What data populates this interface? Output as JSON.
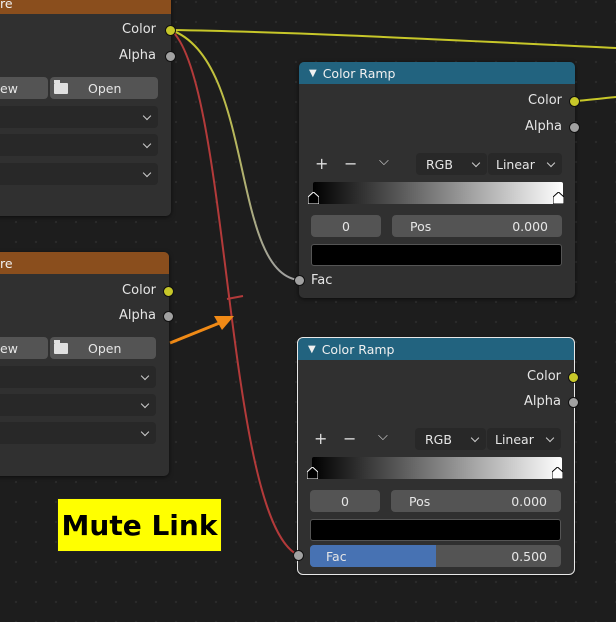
{
  "texture_node_1": {
    "title": "re",
    "outputs": [
      "Color",
      "Alpha"
    ],
    "new_label": "ew",
    "open_label": "Open"
  },
  "texture_node_2": {
    "title": "re",
    "outputs": [
      "Color",
      "Alpha"
    ],
    "new_label": "ew",
    "open_label": "Open"
  },
  "color_ramp_1": {
    "title": "Color Ramp",
    "outputs": [
      "Color",
      "Alpha"
    ],
    "tools": {
      "add": "+",
      "remove": "−",
      "menu": "⌵"
    },
    "color_mode": "RGB",
    "interpolation": "Linear",
    "stop_index": "0",
    "pos_label": "Pos",
    "pos_value": "0.000",
    "input_label": "Fac"
  },
  "color_ramp_2": {
    "title": "Color Ramp",
    "outputs": [
      "Color",
      "Alpha"
    ],
    "tools": {
      "add": "+",
      "remove": "−",
      "menu": "⌵"
    },
    "color_mode": "RGB",
    "interpolation": "Linear",
    "stop_index": "0",
    "pos_label": "Pos",
    "pos_value": "0.000",
    "input_label": "Fac",
    "fac_value": "0.500",
    "fac_fraction": 0.5
  },
  "annotation": {
    "text": "Mute Link"
  },
  "colors": {
    "texture_header": "#8a4e1d",
    "ramp_header": "#22637f",
    "color_socket": "#c7c729",
    "value_socket": "#a1a1a1",
    "muted_link": "#b33a3a",
    "arrow": "#f08a16",
    "annotation_bg": "#ffff00"
  }
}
